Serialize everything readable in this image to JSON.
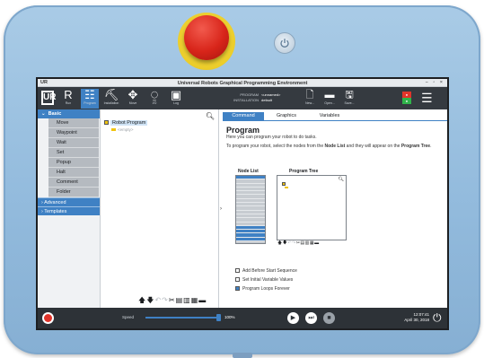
{
  "window": {
    "logo": "UR",
    "title": "Universal Robots Graphical Programming Environment",
    "controls": "− ◦ ×"
  },
  "toolbar": {
    "logo": "UR",
    "items": [
      {
        "label": "Run",
        "icon": "run-icon",
        "glyph": "R",
        "active": false
      },
      {
        "label": "Program",
        "icon": "program-icon",
        "glyph": "☷",
        "active": true
      },
      {
        "label": "Installation",
        "icon": "installation-icon",
        "glyph": "⛏",
        "active": false
      },
      {
        "label": "Move",
        "icon": "move-icon",
        "glyph": "✥",
        "active": false
      },
      {
        "label": "I/O",
        "icon": "io-icon",
        "glyph": "⍜",
        "active": false
      },
      {
        "label": "Log",
        "icon": "log-icon",
        "glyph": "▣",
        "active": false
      }
    ],
    "program_key": "PROGRAM",
    "program_value": "<unnamed>",
    "installation_key": "INSTALLATION",
    "installation_value": "default",
    "file_buttons": [
      {
        "label": "New...",
        "icon": "new-file-icon",
        "glyph": "🗋"
      },
      {
        "label": "Open...",
        "icon": "open-folder-icon",
        "glyph": "▬"
      },
      {
        "label": "Save...",
        "icon": "save-icon",
        "glyph": "🖫"
      }
    ],
    "status_top": "●",
    "status_bottom": "●",
    "menu_glyph": "☰"
  },
  "sidebar": {
    "basic_label": "Basic",
    "basic_items": [
      "Move",
      "Waypoint",
      "Wait",
      "Set",
      "Popup",
      "Halt",
      "Comment",
      "Folder"
    ],
    "advanced_label": "Advanced",
    "templates_label": "Templates"
  },
  "tree": {
    "root_label": "Robot Program",
    "child_label": "<empty>",
    "tools": [
      "🡅",
      "🡇",
      "↶",
      "↷",
      "✂",
      "▤",
      "▥",
      "▦",
      "▬"
    ]
  },
  "content": {
    "tabs": [
      "Command",
      "Graphics",
      "Variables"
    ],
    "title": "Program",
    "subtitle": "Here you can program your robot to do tasks.",
    "desc_pre": "To program your robot, select the nodes from the ",
    "desc_bold1": "Node List",
    "desc_mid": " and they will appear on the ",
    "desc_bold2": "Program Tree",
    "desc_post": ".",
    "node_list_label": "Node List",
    "program_tree_label": "Program Tree",
    "checkboxes": [
      {
        "label": "Add Before Start Sequence",
        "checked": false
      },
      {
        "label": "Set Initial Variable Values",
        "checked": false
      },
      {
        "label": "Program Loops Forever",
        "checked": true
      }
    ]
  },
  "bottom": {
    "speed_label": "Speed",
    "speed_value": "100%",
    "speed_fraction": 1.0,
    "controls": [
      {
        "name": "play-button",
        "glyph": "▶"
      },
      {
        "name": "step-button",
        "glyph": "⏭"
      },
      {
        "name": "stop-button",
        "glyph": "■"
      }
    ],
    "time": "12:07:41",
    "date": "April 30, 2018"
  },
  "colors": {
    "accent": "#3f81c4",
    "estop": "#d8251a",
    "estop_ring": "#eccd2a",
    "housing": "#93bbdd"
  }
}
